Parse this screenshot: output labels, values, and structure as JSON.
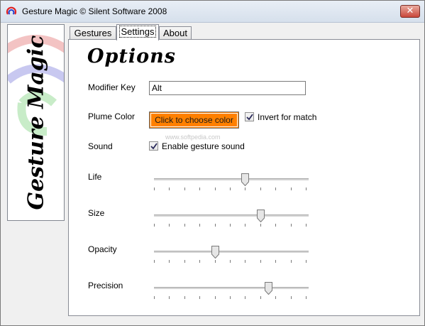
{
  "window": {
    "title": "Gesture Magic © Silent Software 2008",
    "close_label": "✕"
  },
  "banner": {
    "logo_text": "Gesture Magic"
  },
  "tabs": [
    {
      "label": "Gestures",
      "active": false
    },
    {
      "label": "Settings",
      "active": true
    },
    {
      "label": "About",
      "active": false
    }
  ],
  "options": {
    "heading": "Options",
    "modifier_key": {
      "label": "Modifier Key",
      "value": "Alt"
    },
    "plume_color": {
      "label": "Plume Color",
      "button_label": "Click to choose color",
      "color": "#ff8000"
    },
    "invert_for_match": {
      "label": "Invert for match",
      "checked": true
    },
    "sound": {
      "label": "Sound",
      "checkbox_label": "Enable gesture sound",
      "checked": true
    },
    "watermark": "www.softpedia.com",
    "sliders": [
      {
        "label": "Life",
        "value": 0.6
      },
      {
        "label": "Size",
        "value": 0.7
      },
      {
        "label": "Opacity",
        "value": 0.4
      },
      {
        "label": "Precision",
        "value": 0.75
      }
    ]
  }
}
